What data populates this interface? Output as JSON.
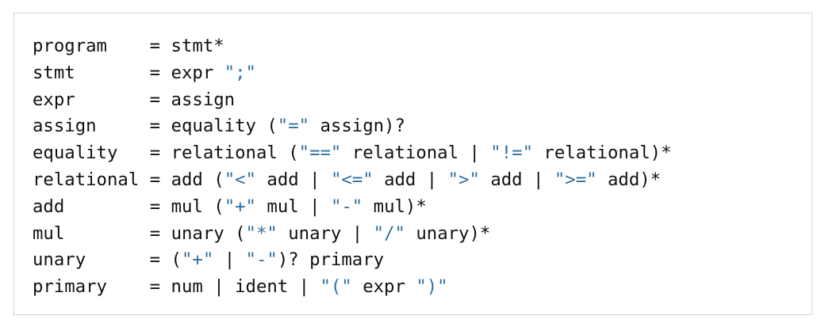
{
  "colors": {
    "text": "#111111",
    "string": "#2f6f9f",
    "border": "#d4d4d4",
    "background": "#ffffff"
  },
  "grammar": {
    "rules": [
      {
        "name": "program",
        "tokens": [
          {
            "t": "text",
            "v": "stmt*"
          }
        ]
      },
      {
        "name": "stmt",
        "tokens": [
          {
            "t": "text",
            "v": "expr "
          },
          {
            "t": "str",
            "v": "\";\""
          }
        ]
      },
      {
        "name": "expr",
        "tokens": [
          {
            "t": "text",
            "v": "assign"
          }
        ]
      },
      {
        "name": "assign",
        "tokens": [
          {
            "t": "text",
            "v": "equality ("
          },
          {
            "t": "str",
            "v": "\"=\""
          },
          {
            "t": "text",
            "v": " assign)?"
          }
        ]
      },
      {
        "name": "equality",
        "tokens": [
          {
            "t": "text",
            "v": "relational ("
          },
          {
            "t": "str",
            "v": "\"==\""
          },
          {
            "t": "text",
            "v": " relational | "
          },
          {
            "t": "str",
            "v": "\"!=\""
          },
          {
            "t": "text",
            "v": " relational)*"
          }
        ]
      },
      {
        "name": "relational",
        "tokens": [
          {
            "t": "text",
            "v": "add ("
          },
          {
            "t": "str",
            "v": "\"<\""
          },
          {
            "t": "text",
            "v": " add | "
          },
          {
            "t": "str",
            "v": "\"<=\""
          },
          {
            "t": "text",
            "v": " add | "
          },
          {
            "t": "str",
            "v": "\">\""
          },
          {
            "t": "text",
            "v": " add | "
          },
          {
            "t": "str",
            "v": "\">=\""
          },
          {
            "t": "text",
            "v": " add)*"
          }
        ]
      },
      {
        "name": "add",
        "tokens": [
          {
            "t": "text",
            "v": "mul ("
          },
          {
            "t": "str",
            "v": "\"+\""
          },
          {
            "t": "text",
            "v": " mul | "
          },
          {
            "t": "str",
            "v": "\"-\""
          },
          {
            "t": "text",
            "v": " mul)*"
          }
        ]
      },
      {
        "name": "mul",
        "tokens": [
          {
            "t": "text",
            "v": "unary ("
          },
          {
            "t": "str",
            "v": "\"*\""
          },
          {
            "t": "text",
            "v": " unary | "
          },
          {
            "t": "str",
            "v": "\"/\""
          },
          {
            "t": "text",
            "v": " unary)*"
          }
        ]
      },
      {
        "name": "unary",
        "tokens": [
          {
            "t": "text",
            "v": "("
          },
          {
            "t": "str",
            "v": "\"+\""
          },
          {
            "t": "text",
            "v": " | "
          },
          {
            "t": "str",
            "v": "\"-\""
          },
          {
            "t": "text",
            "v": ")? primary"
          }
        ]
      },
      {
        "name": "primary",
        "tokens": [
          {
            "t": "text",
            "v": "num | ident | "
          },
          {
            "t": "str",
            "v": "\"(\""
          },
          {
            "t": "text",
            "v": " expr "
          },
          {
            "t": "str",
            "v": "\")\""
          }
        ]
      }
    ],
    "assign_op": "="
  }
}
